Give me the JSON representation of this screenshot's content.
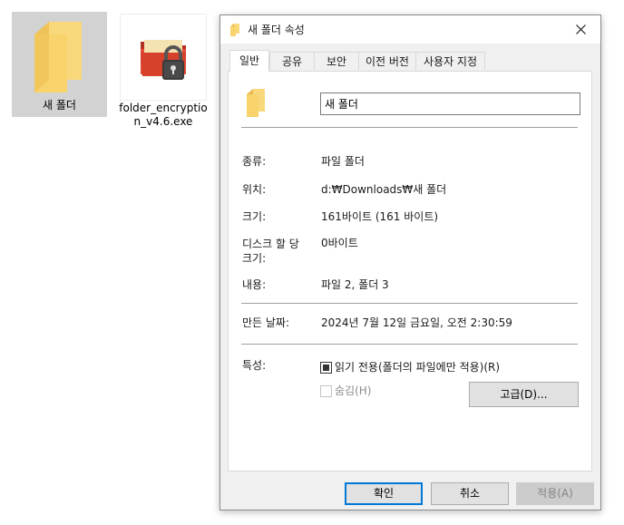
{
  "desktop": {
    "folder_label": "새 폴더",
    "exe_label": "folder_encryption_v4.6.exe"
  },
  "dialog": {
    "title": "새 폴더 속성",
    "tabs": [
      {
        "label": "일반",
        "active": true
      },
      {
        "label": "공유",
        "active": false
      },
      {
        "label": "보안",
        "active": false
      },
      {
        "label": "이전 버전",
        "active": false
      },
      {
        "label": "사용자 지정",
        "active": false
      }
    ],
    "name_value": "새 폴더",
    "rows": {
      "type_label": "종류:",
      "type_value": "파일 폴더",
      "location_label": "위치:",
      "location_value": "d:₩Downloads₩새 폴더",
      "size_label": "크기:",
      "size_value": "161바이트 (161 바이트)",
      "disk_size_label": "디스크 할 당 크기:",
      "disk_size_value": "0바이트",
      "contents_label": "내용:",
      "contents_value": "파일 2, 폴더 3",
      "created_label": "만든 날짜:",
      "created_value": "2024년 7월 12일 금요일, 오전 2:30:59",
      "attributes_label": "특성:"
    },
    "attributes": {
      "readonly_label": "읽기 전용(폴더의 파일에만 적용)(R)",
      "hidden_label": "숨김(H)",
      "advanced_button": "고급(D)..."
    },
    "buttons": {
      "ok": "확인",
      "cancel": "취소",
      "apply": "적용(A)"
    }
  },
  "colors": {
    "folder_yellow": "#f8d26a",
    "folder_dark": "#e8b84a",
    "accent_blue": "#0078d7",
    "exe_red": "#d6412b"
  }
}
